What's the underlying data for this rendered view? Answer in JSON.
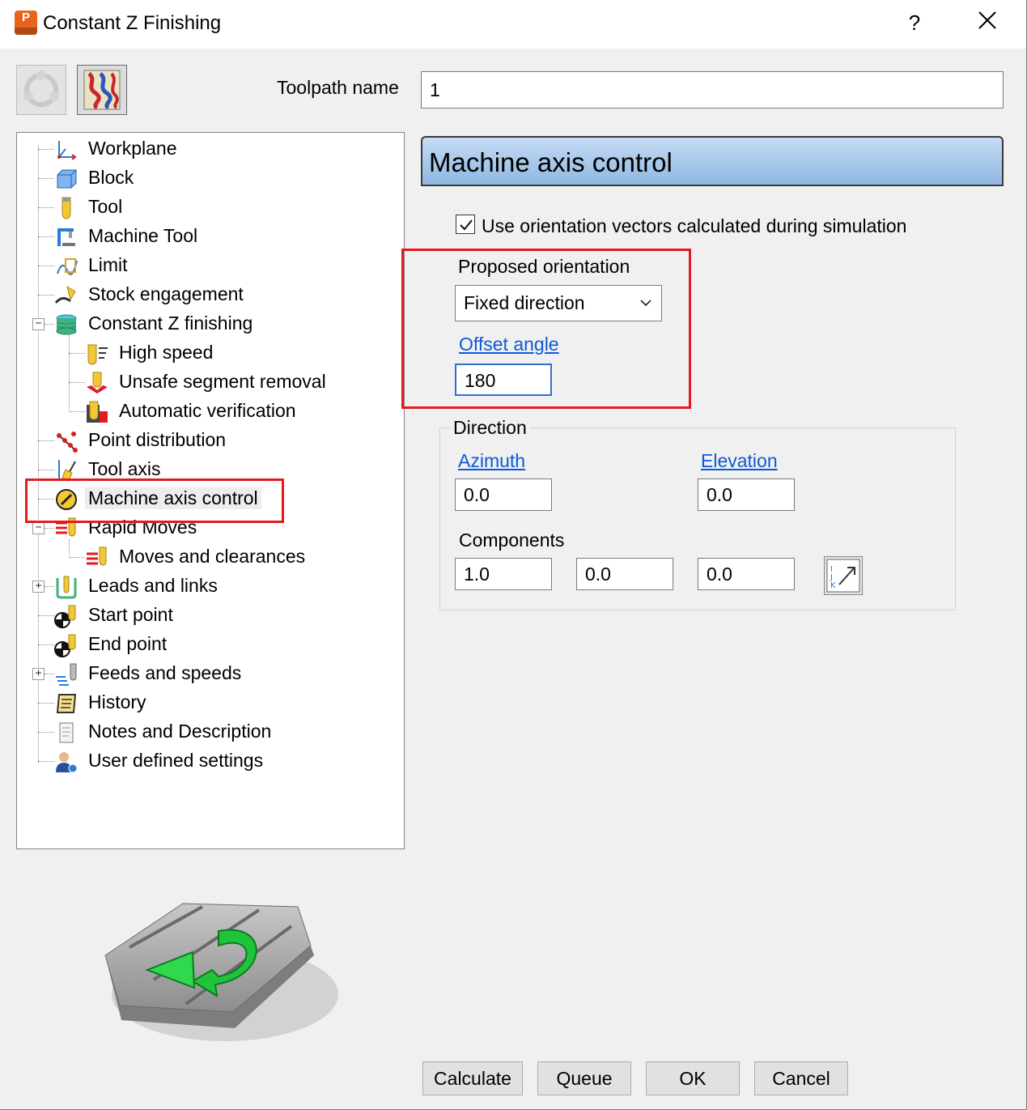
{
  "window": {
    "title": "Constant Z Finishing",
    "help_label": "?",
    "close_label": "✕",
    "app_icon_letter": "P"
  },
  "toolbar": {
    "buttons": [
      {
        "name": "pattern-library-icon"
      },
      {
        "name": "toolpath-thumbnail-icon"
      }
    ]
  },
  "toolpath_name": {
    "label": "Toolpath name",
    "value": "1"
  },
  "tree": {
    "items": [
      {
        "label": "Workplane",
        "icon": "workplane-icon"
      },
      {
        "label": "Block",
        "icon": "block-icon"
      },
      {
        "label": "Tool",
        "icon": "tool-icon"
      },
      {
        "label": "Machine Tool",
        "icon": "machine-tool-icon"
      },
      {
        "label": "Limit",
        "icon": "limit-icon"
      },
      {
        "label": "Stock engagement",
        "icon": "stock-engagement-icon"
      },
      {
        "label": "Constant Z finishing",
        "icon": "constant-z-icon"
      },
      {
        "label": "High speed",
        "icon": "high-speed-icon"
      },
      {
        "label": "Unsafe segment removal",
        "icon": "unsafe-segment-icon"
      },
      {
        "label": "Automatic verification",
        "icon": "verification-icon"
      },
      {
        "label": "Point distribution",
        "icon": "point-distribution-icon"
      },
      {
        "label": "Tool axis",
        "icon": "tool-axis-icon"
      },
      {
        "label": "Machine axis control",
        "icon": "machine-axis-control-icon",
        "selected": true
      },
      {
        "label": "Rapid Moves",
        "icon": "rapid-moves-icon"
      },
      {
        "label": "Moves and clearances",
        "icon": "moves-clearances-icon"
      },
      {
        "label": "Leads and links",
        "icon": "leads-links-icon"
      },
      {
        "label": "Start point",
        "icon": "start-point-icon"
      },
      {
        "label": "End point",
        "icon": "end-point-icon"
      },
      {
        "label": "Feeds and speeds",
        "icon": "feeds-speeds-icon"
      },
      {
        "label": "History",
        "icon": "history-icon"
      },
      {
        "label": "Notes and Description",
        "icon": "notes-icon"
      },
      {
        "label": "User defined settings",
        "icon": "user-settings-icon"
      }
    ],
    "expander_collapse": "−",
    "expander_expand": "+"
  },
  "panel": {
    "title": "Machine axis control",
    "use_orientation_label": "Use orientation vectors calculated during simulation",
    "use_orientation_checked": true,
    "proposed_orientation_label": "Proposed orientation",
    "proposed_orientation_value": "Fixed direction",
    "offset_angle_label": "Offset angle",
    "offset_angle_value": "180",
    "direction": {
      "title": "Direction",
      "azimuth_label": "Azimuth",
      "azimuth_value": "0.0",
      "elevation_label": "Elevation",
      "elevation_value": "0.0",
      "components_label": "Components",
      "components": [
        "1.0",
        "0.0",
        "0.0"
      ]
    }
  },
  "footer": {
    "calculate": "Calculate",
    "queue": "Queue",
    "ok": "OK",
    "cancel": "Cancel"
  },
  "colors": {
    "highlight_box": "#e11b22",
    "link": "#0b5ad6",
    "header_gradient_top": "#c5dcf3",
    "header_gradient_bottom": "#8fb8e2",
    "app_icon": "#e8641c"
  }
}
